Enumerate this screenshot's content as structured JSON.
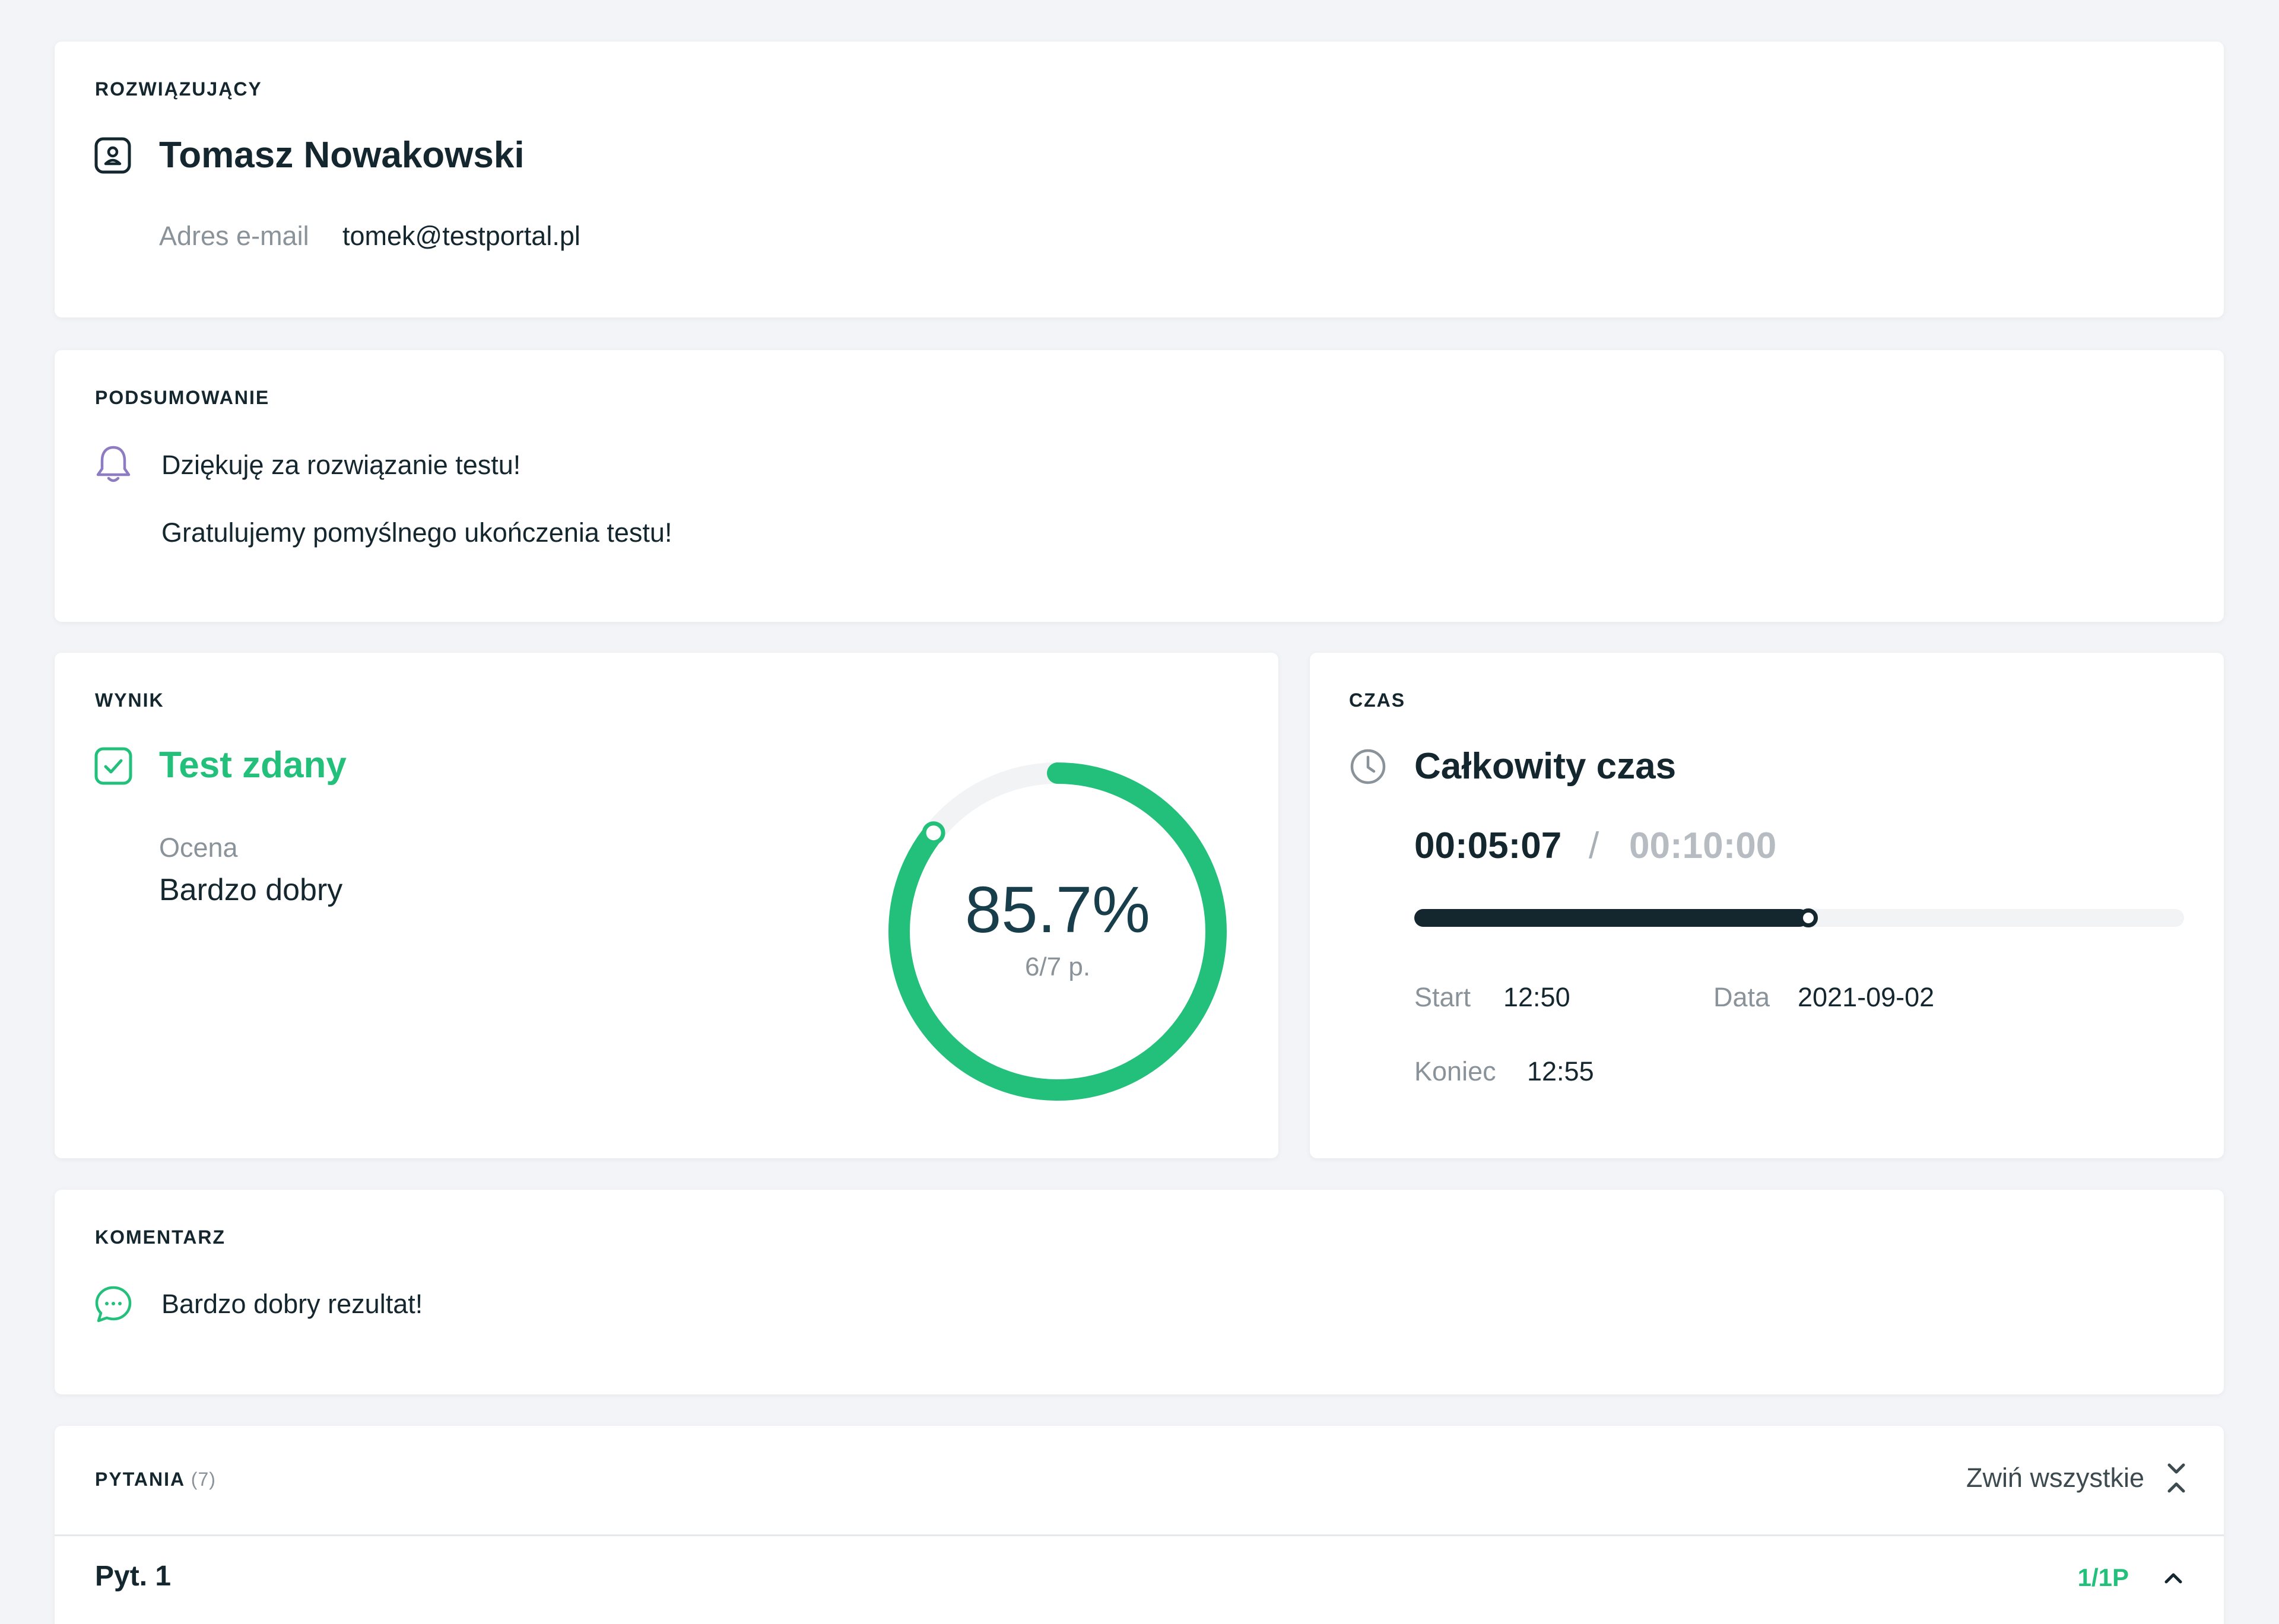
{
  "solver": {
    "section_label": "ROZWIĄZUJĄCY",
    "name": "Tomasz Nowakowski",
    "email_label": "Adres e-mail",
    "email_value": "tomek@testportal.pl",
    "icon": "user-badge-icon"
  },
  "summary": {
    "section_label": "PODSUMOWANIE",
    "line1": "Dziękuję za rozwiązanie testu!",
    "line2": "Gratulujemy pomyślnego ukończenia testu!",
    "icon": "bell-icon"
  },
  "result": {
    "section_label": "WYNIK",
    "status": "Test zdany",
    "status_color": "#22c07a",
    "grade_label": "Ocena",
    "grade_value": "Bardzo dobry",
    "percent_text": "85.7%",
    "points_text": "6/7 p.",
    "percent_value": 0.857,
    "icon": "check-square-icon"
  },
  "time": {
    "section_label": "CZAS",
    "title": "Całkowity czas",
    "elapsed": "00:05:07",
    "separator": "/",
    "limit": "00:10:00",
    "progress_value": 0.512,
    "start_label": "Start",
    "start_value": "12:50",
    "date_label": "Data",
    "date_value": "2021-09-02",
    "end_label": "Koniec",
    "end_value": "12:55",
    "icon": "clock-icon"
  },
  "comment": {
    "section_label": "KOMENTARZ",
    "text": "Bardzo dobry rezultat!",
    "icon": "chat-bubble-icon"
  },
  "questions": {
    "section_label": "PYTANIA",
    "count": "(7)",
    "collapse_all": "Zwiń wszystkie",
    "collapse_icon": "collapse-all-icon",
    "items": [
      {
        "label": "Pyt. 1",
        "score": "1/1P",
        "toggle_icon": "chevron-up-icon"
      }
    ]
  },
  "colors": {
    "accent_green": "#22c07a",
    "dark": "#14262e",
    "muted": "#8a9399",
    "purple": "#8e7cc3"
  }
}
